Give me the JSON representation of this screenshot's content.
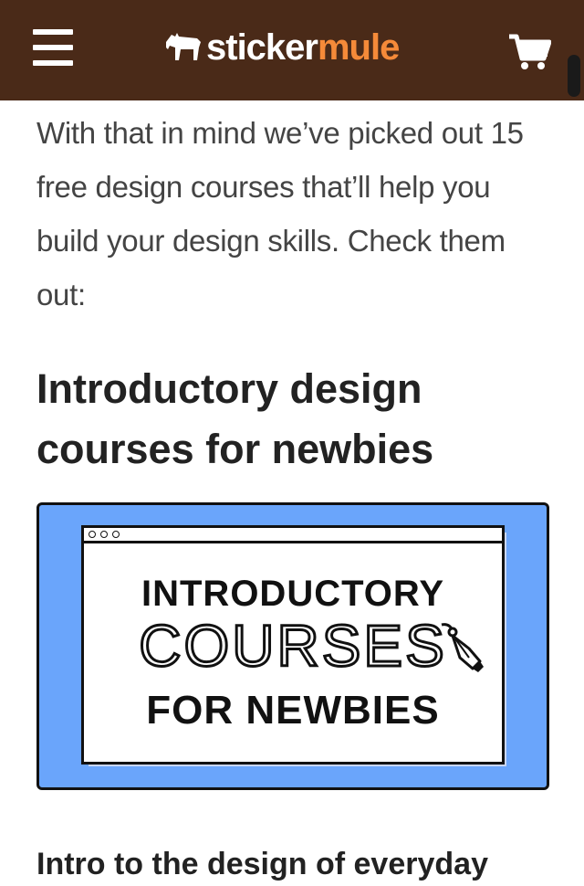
{
  "header": {
    "logo_word1": "sticker",
    "logo_word2": "mule",
    "bg_color": "#4a2a18",
    "accent_color": "#f58a39",
    "menu_icon": "hamburger-menu-icon",
    "cart_icon": "shopping-cart-icon"
  },
  "article": {
    "intro": "With that in mind we’ve picked out 15 free design courses that’ll help you build your design skills. Check them out:",
    "heading": "Introductory design courses for newbies",
    "banner": {
      "line1": "INTRODUCTORY",
      "line2": "COURSES",
      "line3": "FOR NEWBIES",
      "bg_color": "#6aa5fb"
    },
    "subheading": "Intro to the design of everyday"
  }
}
